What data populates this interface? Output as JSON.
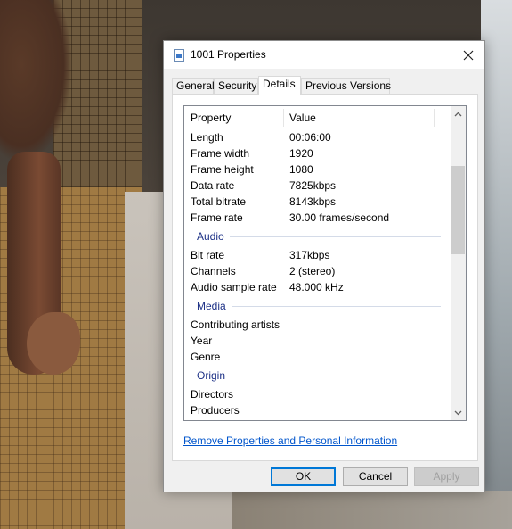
{
  "window": {
    "title": "1001 Properties"
  },
  "tabs": [
    {
      "label": "General"
    },
    {
      "label": "Security"
    },
    {
      "label": "Details"
    },
    {
      "label": "Previous Versions"
    }
  ],
  "active_tab": "Details",
  "columns": {
    "property": "Property",
    "value": "Value"
  },
  "rows": [
    {
      "key": "Length",
      "value": "00:06:00"
    },
    {
      "key": "Frame width",
      "value": "1920"
    },
    {
      "key": "Frame height",
      "value": "1080"
    },
    {
      "key": "Data rate",
      "value": "7825kbps"
    },
    {
      "key": "Total bitrate",
      "value": "8143kbps"
    },
    {
      "key": "Frame rate",
      "value": "30.00 frames/second"
    }
  ],
  "groups": {
    "audio": {
      "name": "Audio",
      "rows": [
        {
          "key": "Bit rate",
          "value": "317kbps"
        },
        {
          "key": "Channels",
          "value": "2 (stereo)"
        },
        {
          "key": "Audio sample rate",
          "value": "48.000 kHz"
        }
      ]
    },
    "media": {
      "name": "Media",
      "rows": [
        {
          "key": "Contributing artists",
          "value": ""
        },
        {
          "key": "Year",
          "value": ""
        },
        {
          "key": "Genre",
          "value": ""
        }
      ]
    },
    "origin": {
      "name": "Origin",
      "rows": [
        {
          "key": "Directors",
          "value": ""
        },
        {
          "key": "Producers",
          "value": ""
        }
      ]
    }
  },
  "links": {
    "remove_properties": "Remove Properties and Personal Information"
  },
  "buttons": {
    "ok": "OK",
    "cancel": "Cancel",
    "apply": "Apply"
  },
  "icons": {
    "close": "close-icon",
    "file": "file-icon",
    "scroll_up": "chevron-up-icon",
    "scroll_down": "chevron-down-icon"
  },
  "colors": {
    "link": "#0055cc",
    "group_header": "#1e3287",
    "default_button_border": "#0078d7"
  },
  "scroll": {
    "thumb_position_fraction": 0.23,
    "visible_fraction": 0.31
  }
}
